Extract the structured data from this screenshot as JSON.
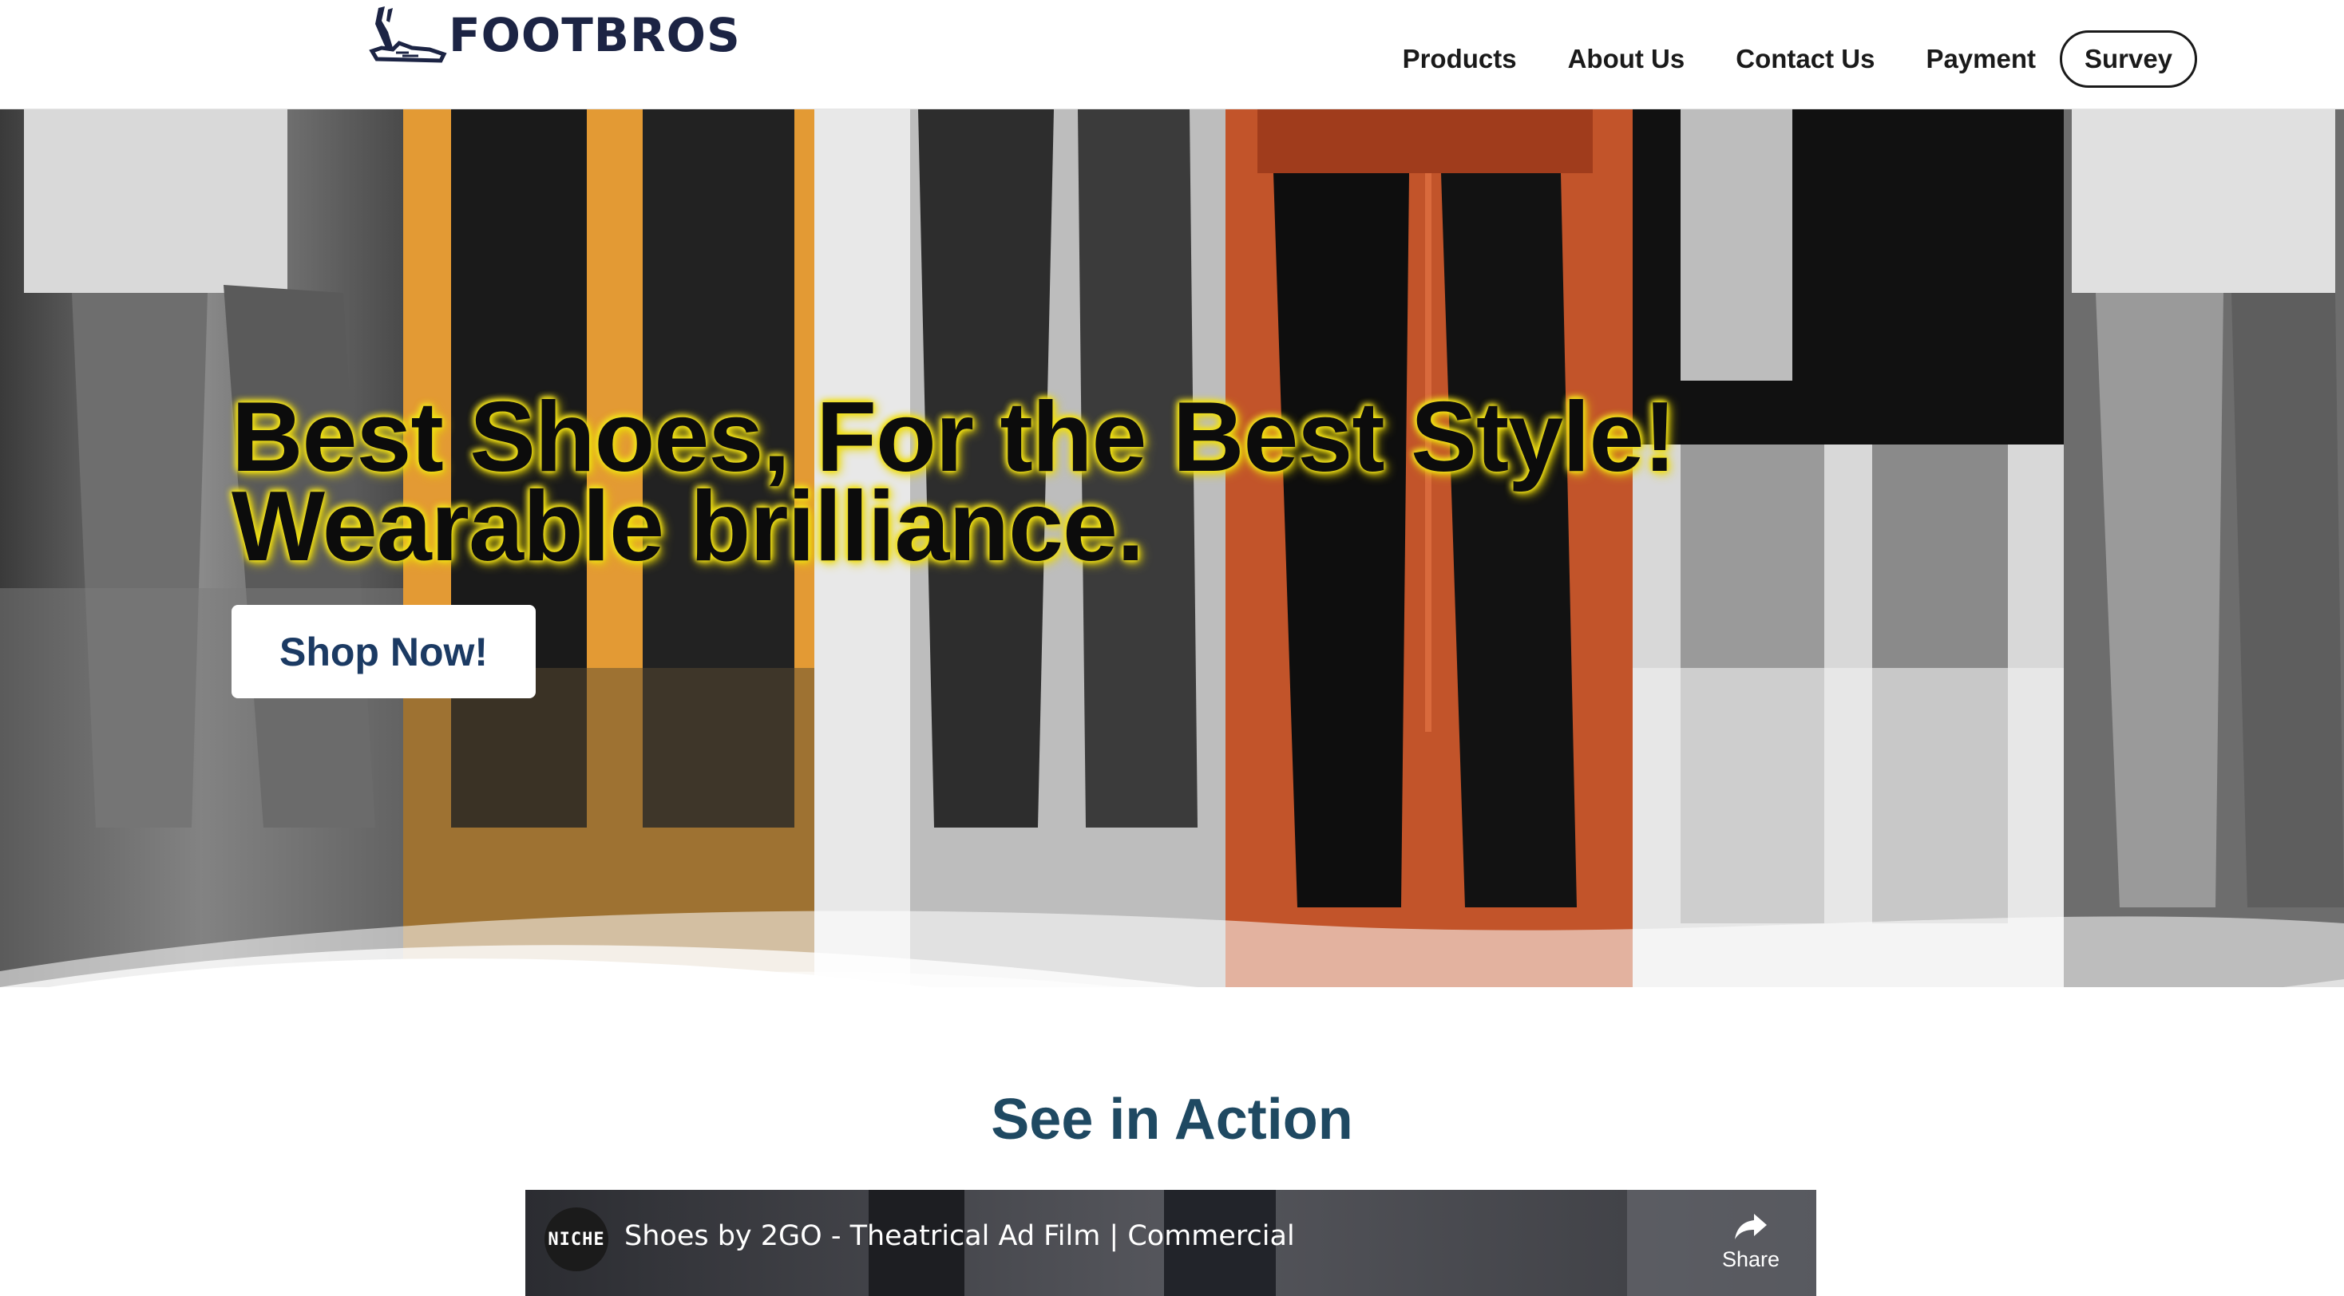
{
  "brand": {
    "name": "FOOTBROS",
    "logo_icon": "shoe-logo-icon",
    "color": "#1c2444"
  },
  "nav": {
    "items": [
      {
        "label": "Products"
      },
      {
        "label": "About Us"
      },
      {
        "label": "Contact Us"
      },
      {
        "label": "Payment"
      }
    ],
    "survey_label": "Survey"
  },
  "hero": {
    "title_line1": "Best Shoes, For the Best Style!",
    "title_line2": "Wearable brilliance.",
    "cta_label": "Shop Now!",
    "glow_color": "#f2e21a"
  },
  "section": {
    "title": "See in Action",
    "title_color": "#1f4962"
  },
  "video": {
    "channel_badge": "NICHE",
    "title": "Shoes by 2GO - Theatrical Ad Film | Commercial",
    "share_label": "Share",
    "share_icon": "share-arrow-icon"
  }
}
